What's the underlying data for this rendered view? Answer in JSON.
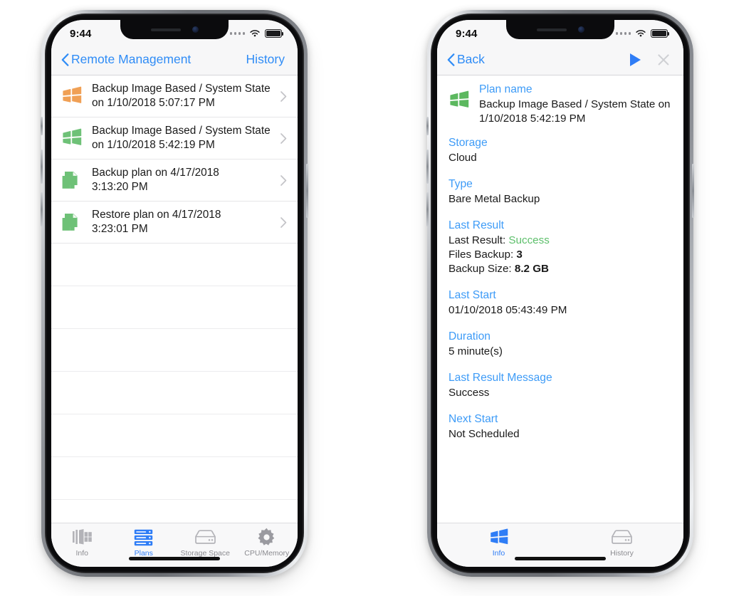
{
  "left_phone": {
    "status_bar": {
      "time": "9:44",
      "wifi_icon": "wifi-icon",
      "battery_icon": "battery-full-icon",
      "signal_icon": "signal-dots-icon"
    },
    "nav": {
      "back_label": "Remote Management",
      "back_icon": "chevron-left-icon",
      "right_action": "History"
    },
    "plans": [
      {
        "icon": "windows-flag-orange-icon",
        "icon_color": "#f0a055",
        "title": "Backup Image Based / System State",
        "subtitle": "on 1/10/2018 5:07:17 PM",
        "chevron": "chevron-right-icon"
      },
      {
        "icon": "windows-flag-green-icon",
        "icon_color": "#6ec177",
        "title": "Backup Image Based / System State",
        "subtitle": "on 1/10/2018 5:42:19 PM",
        "chevron": "chevron-right-icon"
      },
      {
        "icon": "file-plan-green-icon",
        "icon_color": "#6ec177",
        "title": "Backup plan on 4/17/2018",
        "subtitle": "3:13:20 PM",
        "chevron": "chevron-right-icon"
      },
      {
        "icon": "file-plan-green-icon",
        "icon_color": "#6ec177",
        "title": "Restore plan on 4/17/2018",
        "subtitle": "3:23:01 PM",
        "chevron": "chevron-right-icon"
      }
    ],
    "empty_rows": 6,
    "tabs": [
      {
        "label": "Info",
        "icon": "info-windows-bars-icon",
        "active": false
      },
      {
        "label": "Plans",
        "icon": "server-stack-icon",
        "active": true
      },
      {
        "label": "Storage Space",
        "icon": "disk-drive-icon",
        "active": false
      },
      {
        "label": "CPU/Memory",
        "icon": "gear-icon",
        "active": false
      }
    ]
  },
  "right_phone": {
    "status_bar": {
      "time": "9:44",
      "wifi_icon": "wifi-icon",
      "battery_icon": "battery-full-icon",
      "signal_icon": "signal-dots-icon"
    },
    "nav": {
      "back_label": "Back",
      "back_icon": "chevron-left-icon",
      "play_icon": "play-icon",
      "close_icon": "close-icon"
    },
    "plan_icon": "windows-flag-green-icon",
    "fields": [
      {
        "label": "Plan name",
        "value": "Backup Image Based / System State on 1/10/2018 5:42:19 PM"
      },
      {
        "label": "Storage",
        "value": "Cloud"
      },
      {
        "label": "Type",
        "value": "Bare Metal Backup"
      },
      {
        "label": "Last Result",
        "lines": [
          {
            "prefix": "Last Result: ",
            "strong": "Success",
            "strong_style": "success"
          },
          {
            "prefix": "Files Backup: ",
            "strong": "3",
            "strong_style": "bold"
          },
          {
            "prefix": "Backup Size: ",
            "strong": "8.2 GB",
            "strong_style": "bold"
          }
        ]
      },
      {
        "label": "Last Start",
        "value": "01/10/2018 05:43:49 PM"
      },
      {
        "label": "Duration",
        "value": "5 minute(s)"
      },
      {
        "label": "Last Result Message",
        "value": "Success"
      },
      {
        "label": "Next Start",
        "value": "Not Scheduled"
      }
    ],
    "tabs": [
      {
        "label": "Info",
        "icon": "windows-flag-blue-icon",
        "active": true
      },
      {
        "label": "History",
        "icon": "disk-drive-icon",
        "active": false
      }
    ]
  },
  "colors": {
    "accent_blue": "#2f7df6",
    "label_blue": "#3d9bf7",
    "success_green": "#5cbf6a",
    "icon_orange": "#f0a055",
    "icon_green": "#6ec177",
    "inactive_gray": "#8b8b90"
  }
}
